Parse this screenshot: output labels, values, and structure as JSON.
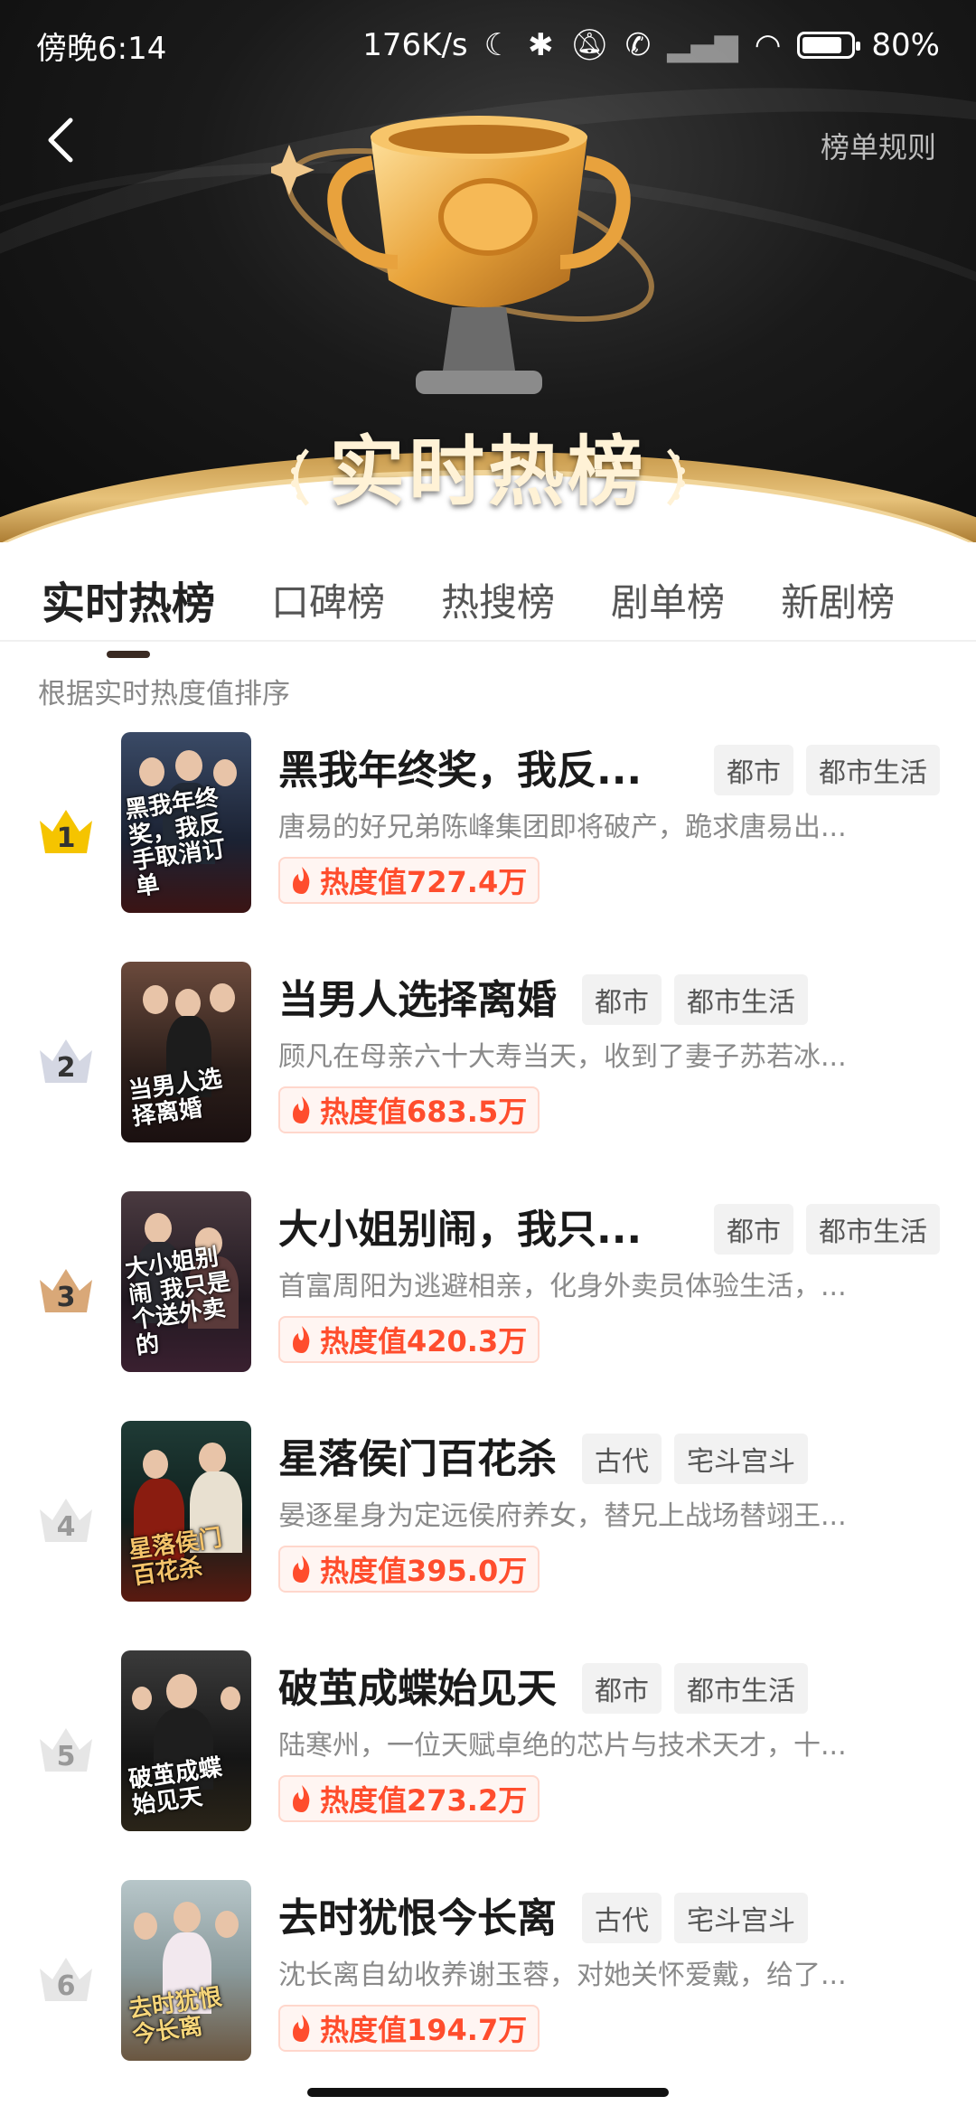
{
  "status": {
    "time": "傍晚6:14",
    "speed": "176K/s",
    "battery": "80%"
  },
  "header": {
    "rules_link": "榜单规则",
    "hero_title": "实时热榜"
  },
  "tabs": [
    {
      "label": "实时热榜",
      "active": true
    },
    {
      "label": "口碑榜"
    },
    {
      "label": "热搜榜"
    },
    {
      "label": "剧单榜"
    },
    {
      "label": "新剧榜"
    }
  ],
  "sort_note": "根据实时热度值排序",
  "items": [
    {
      "rank": "1",
      "title": "黑我年终奖，我反...",
      "tags": [
        "都市",
        "都市生活"
      ],
      "desc": "唐易的好兄弟陈峰集团即将破产，跪求唐易出...",
      "heat": "热度值727.4万",
      "cover_text": "黑我年终奖，我反手取消订单"
    },
    {
      "rank": "2",
      "title": "当男人选择离婚",
      "tags": [
        "都市",
        "都市生活"
      ],
      "desc": "顾凡在母亲六十大寿当天，收到了妻子苏若冰...",
      "heat": "热度值683.5万",
      "cover_text": "当男人选择离婚"
    },
    {
      "rank": "3",
      "title": "大小姐别闹，我只...",
      "tags": [
        "都市",
        "都市生活"
      ],
      "desc": "首富周阳为逃避相亲，化身外卖员体验生活，...",
      "heat": "热度值420.3万",
      "cover_text": "大小姐别闹 我只是个送外卖的"
    },
    {
      "rank": "4",
      "title": "星落侯门百花杀",
      "tags": [
        "古代",
        "宅斗宫斗"
      ],
      "desc": "晏逐星身为定远侯府养女，替兄上战场替翊王...",
      "heat": "热度值395.0万",
      "cover_text": "星落侯门百花杀"
    },
    {
      "rank": "5",
      "title": "破茧成蝶始见天",
      "tags": [
        "都市",
        "都市生活"
      ],
      "desc": "陆寒州，一位天赋卓绝的芯片与技术天才，十...",
      "heat": "热度值273.2万",
      "cover_text": "破茧成蝶始见天"
    },
    {
      "rank": "6",
      "title": "去时犹恨今长离",
      "tags": [
        "古代",
        "宅斗宫斗"
      ],
      "desc": "沈长离自幼收养谢玉蓉，对她关怀爱戴，给了...",
      "heat": "热度值194.7万",
      "cover_text": "去时犹恨今长离"
    }
  ]
}
